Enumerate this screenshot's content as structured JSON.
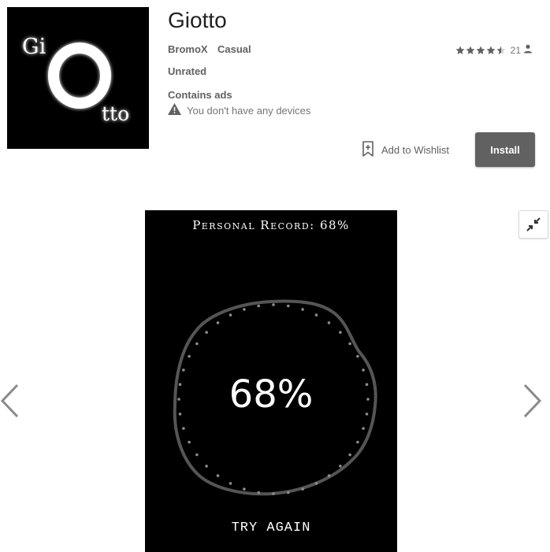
{
  "app": {
    "title": "Giotto",
    "developer": "BromoX",
    "category": "Casual",
    "content_rating": "Unrated",
    "ads_notice": "Contains ads",
    "devices_notice": "You don't have any devices",
    "rating_stars": 4.5,
    "rating_count": "21",
    "logo_text": {
      "part1": "Gi",
      "part2": "tto"
    }
  },
  "actions": {
    "wishlist_label": "Add to Wishlist",
    "install_label": "Install"
  },
  "screenshot": {
    "record_text": "Personal Record: 68%",
    "percent_text": "68%",
    "try_again_text": "TRY AGAIN"
  },
  "icons": {
    "warning": "warning-icon",
    "wishlist": "bookmark-add-icon",
    "person": "person-icon",
    "star": "star-icon",
    "prev": "chevron-left-icon",
    "next": "chevron-right-icon",
    "exit_fullscreen": "exit-fullscreen-icon"
  },
  "colors": {
    "install_bg": "#616161",
    "text_secondary": "#757575",
    "star": "#616161"
  }
}
